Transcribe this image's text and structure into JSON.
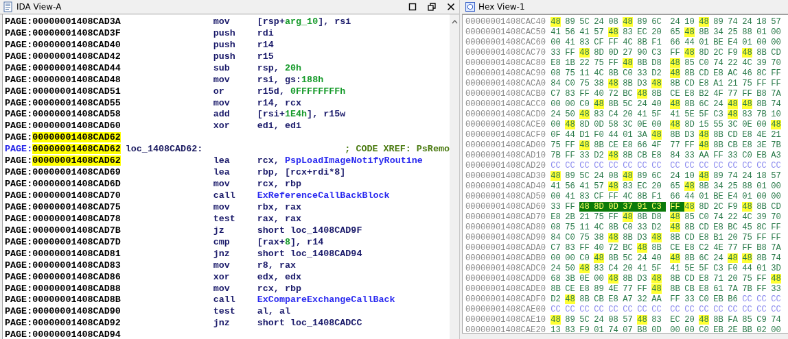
{
  "ida_view": {
    "title": "IDA View-A",
    "rows": [
      {
        "kind": "code",
        "seg": "PAGE:",
        "addr": "00000001408CAD3A",
        "highlight": false,
        "mnemonic": "mov",
        "operands": [
          {
            "text": "[rsp+",
            "kind": "plain"
          },
          {
            "text": "arg_10",
            "kind": "num"
          },
          {
            "text": "], rsi",
            "kind": "plain"
          }
        ]
      },
      {
        "kind": "code",
        "seg": "PAGE:",
        "addr": "00000001408CAD3F",
        "highlight": false,
        "mnemonic": "push",
        "operands": [
          {
            "text": "rdi",
            "kind": "plain"
          }
        ]
      },
      {
        "kind": "code",
        "seg": "PAGE:",
        "addr": "00000001408CAD40",
        "highlight": false,
        "mnemonic": "push",
        "operands": [
          {
            "text": "r14",
            "kind": "plain"
          }
        ]
      },
      {
        "kind": "code",
        "seg": "PAGE:",
        "addr": "00000001408CAD42",
        "highlight": false,
        "mnemonic": "push",
        "operands": [
          {
            "text": "r15",
            "kind": "plain"
          }
        ]
      },
      {
        "kind": "code",
        "seg": "PAGE:",
        "addr": "00000001408CAD44",
        "highlight": false,
        "mnemonic": "sub",
        "operands": [
          {
            "text": "rsp, ",
            "kind": "plain"
          },
          {
            "text": "20h",
            "kind": "num"
          }
        ]
      },
      {
        "kind": "code",
        "seg": "PAGE:",
        "addr": "00000001408CAD48",
        "highlight": false,
        "mnemonic": "mov",
        "operands": [
          {
            "text": "rsi, gs:",
            "kind": "plain"
          },
          {
            "text": "188h",
            "kind": "num"
          }
        ]
      },
      {
        "kind": "code",
        "seg": "PAGE:",
        "addr": "00000001408CAD51",
        "highlight": false,
        "mnemonic": "or",
        "operands": [
          {
            "text": "r15d, ",
            "kind": "plain"
          },
          {
            "text": "0FFFFFFFFh",
            "kind": "num"
          }
        ]
      },
      {
        "kind": "code",
        "seg": "PAGE:",
        "addr": "00000001408CAD55",
        "highlight": false,
        "mnemonic": "mov",
        "operands": [
          {
            "text": "r14, rcx",
            "kind": "plain"
          }
        ]
      },
      {
        "kind": "code",
        "seg": "PAGE:",
        "addr": "00000001408CAD58",
        "highlight": false,
        "mnemonic": "add",
        "operands": [
          {
            "text": "[rsi+",
            "kind": "plain"
          },
          {
            "text": "1E4h",
            "kind": "num"
          },
          {
            "text": "], r15w",
            "kind": "plain"
          }
        ]
      },
      {
        "kind": "code",
        "seg": "PAGE:",
        "addr": "00000001408CAD60",
        "highlight": false,
        "mnemonic": "xor",
        "operands": [
          {
            "text": "edi, edi",
            "kind": "plain"
          }
        ]
      },
      {
        "kind": "code",
        "seg": "PAGE:",
        "addr": "00000001408CAD62",
        "highlight": true
      },
      {
        "kind": "label",
        "seg": "PAGE:",
        "addr": "00000001408CAD62",
        "highlight": true,
        "label": "loc_1408CAD62:",
        "comment": "; CODE XREF: PsRemo"
      },
      {
        "kind": "code",
        "seg": "PAGE:",
        "addr": "00000001408CAD62",
        "highlight": true,
        "mnemonic": "lea",
        "operands": [
          {
            "text": "rcx, ",
            "kind": "plain"
          },
          {
            "text": "PspLoadImageNotifyRoutine",
            "kind": "name"
          }
        ]
      },
      {
        "kind": "code",
        "seg": "PAGE:",
        "addr": "00000001408CAD69",
        "highlight": false,
        "mnemonic": "lea",
        "operands": [
          {
            "text": "rbp, [rcx+rdi*8]",
            "kind": "plain"
          }
        ]
      },
      {
        "kind": "code",
        "seg": "PAGE:",
        "addr": "00000001408CAD6D",
        "highlight": false,
        "mnemonic": "mov",
        "operands": [
          {
            "text": "rcx, rbp",
            "kind": "plain"
          }
        ]
      },
      {
        "kind": "code",
        "seg": "PAGE:",
        "addr": "00000001408CAD70",
        "highlight": false,
        "mnemonic": "call",
        "operands": [
          {
            "text": "ExReferenceCallBackBlock",
            "kind": "name"
          }
        ]
      },
      {
        "kind": "code",
        "seg": "PAGE:",
        "addr": "00000001408CAD75",
        "highlight": false,
        "mnemonic": "mov",
        "operands": [
          {
            "text": "rbx, rax",
            "kind": "plain"
          }
        ]
      },
      {
        "kind": "code",
        "seg": "PAGE:",
        "addr": "00000001408CAD78",
        "highlight": false,
        "mnemonic": "test",
        "operands": [
          {
            "text": "rax, rax",
            "kind": "plain"
          }
        ]
      },
      {
        "kind": "code",
        "seg": "PAGE:",
        "addr": "00000001408CAD7B",
        "highlight": false,
        "mnemonic": "jz",
        "operands": [
          {
            "text": "short loc_1408CAD9F",
            "kind": "plain"
          }
        ]
      },
      {
        "kind": "code",
        "seg": "PAGE:",
        "addr": "00000001408CAD7D",
        "highlight": false,
        "mnemonic": "cmp",
        "operands": [
          {
            "text": "[rax+",
            "kind": "plain"
          },
          {
            "text": "8",
            "kind": "num"
          },
          {
            "text": "], r14",
            "kind": "plain"
          }
        ]
      },
      {
        "kind": "code",
        "seg": "PAGE:",
        "addr": "00000001408CAD81",
        "highlight": false,
        "mnemonic": "jnz",
        "operands": [
          {
            "text": "short loc_1408CAD94",
            "kind": "plain"
          }
        ]
      },
      {
        "kind": "code",
        "seg": "PAGE:",
        "addr": "00000001408CAD83",
        "highlight": false,
        "mnemonic": "mov",
        "operands": [
          {
            "text": "r8, rax",
            "kind": "plain"
          }
        ]
      },
      {
        "kind": "code",
        "seg": "PAGE:",
        "addr": "00000001408CAD86",
        "highlight": false,
        "mnemonic": "xor",
        "operands": [
          {
            "text": "edx, edx",
            "kind": "plain"
          }
        ]
      },
      {
        "kind": "code",
        "seg": "PAGE:",
        "addr": "00000001408CAD88",
        "highlight": false,
        "mnemonic": "mov",
        "operands": [
          {
            "text": "rcx, rbp",
            "kind": "plain"
          }
        ]
      },
      {
        "kind": "code",
        "seg": "PAGE:",
        "addr": "00000001408CAD8B",
        "highlight": false,
        "mnemonic": "call",
        "operands": [
          {
            "text": "ExCompareExchangeCallBack",
            "kind": "name"
          }
        ]
      },
      {
        "kind": "code",
        "seg": "PAGE:",
        "addr": "00000001408CAD90",
        "highlight": false,
        "mnemonic": "test",
        "operands": [
          {
            "text": "al, al",
            "kind": "plain"
          }
        ]
      },
      {
        "kind": "code",
        "seg": "PAGE:",
        "addr": "00000001408CAD92",
        "highlight": false,
        "mnemonic": "jnz",
        "operands": [
          {
            "text": "short loc_1408CADCC",
            "kind": "plain"
          }
        ]
      },
      {
        "kind": "code",
        "seg": "PAGE:",
        "addr": "00000001408CAD94",
        "highlight": false
      }
    ]
  },
  "hex_view": {
    "title": "Hex View-1",
    "rows": [
      {
        "addr": "00000001408CAC40",
        "bytes": [
          {
            "v": "48",
            "kind": "match"
          },
          {
            "v": "89"
          },
          {
            "v": "5C"
          },
          {
            "v": "24"
          },
          {
            "v": "08"
          },
          {
            "v": "48",
            "kind": "match"
          },
          {
            "v": "89"
          },
          {
            "v": "6C"
          },
          {
            "v": "24"
          },
          {
            "v": "10"
          },
          {
            "v": "48",
            "kind": "match"
          },
          {
            "v": "89"
          },
          {
            "v": "74"
          },
          {
            "v": "24"
          },
          {
            "v": "18"
          },
          {
            "v": "57"
          }
        ]
      },
      {
        "addr": "00000001408CAC50",
        "bytes": [
          {
            "v": "41"
          },
          {
            "v": "56"
          },
          {
            "v": "41"
          },
          {
            "v": "57"
          },
          {
            "v": "48",
            "kind": "match"
          },
          {
            "v": "83"
          },
          {
            "v": "EC"
          },
          {
            "v": "20"
          },
          {
            "v": "65"
          },
          {
            "v": "48",
            "kind": "match"
          },
          {
            "v": "8B"
          },
          {
            "v": "34"
          },
          {
            "v": "25"
          },
          {
            "v": "88"
          },
          {
            "v": "01"
          },
          {
            "v": "00"
          }
        ]
      },
      {
        "addr": "00000001408CAC60",
        "bytes": [
          {
            "v": "00"
          },
          {
            "v": "41"
          },
          {
            "v": "83"
          },
          {
            "v": "CF"
          },
          {
            "v": "FF"
          },
          {
            "v": "4C"
          },
          {
            "v": "8B"
          },
          {
            "v": "F1"
          },
          {
            "v": "66"
          },
          {
            "v": "44"
          },
          {
            "v": "01"
          },
          {
            "v": "BE"
          },
          {
            "v": "E4"
          },
          {
            "v": "01"
          },
          {
            "v": "00"
          },
          {
            "v": "00"
          }
        ]
      },
      {
        "addr": "00000001408CAC70",
        "bytes": [
          {
            "v": "33"
          },
          {
            "v": "FF"
          },
          {
            "v": "48",
            "kind": "match"
          },
          {
            "v": "8D"
          },
          {
            "v": "0D"
          },
          {
            "v": "27"
          },
          {
            "v": "90"
          },
          {
            "v": "C3"
          },
          {
            "v": "FF"
          },
          {
            "v": "48",
            "kind": "match"
          },
          {
            "v": "8D"
          },
          {
            "v": "2C"
          },
          {
            "v": "F9"
          },
          {
            "v": "48",
            "kind": "match"
          },
          {
            "v": "8B"
          },
          {
            "v": "CD"
          }
        ]
      },
      {
        "addr": "00000001408CAC80",
        "bytes": [
          {
            "v": "E8"
          },
          {
            "v": "1B"
          },
          {
            "v": "22"
          },
          {
            "v": "75"
          },
          {
            "v": "FF"
          },
          {
            "v": "48",
            "kind": "match"
          },
          {
            "v": "8B"
          },
          {
            "v": "D8"
          },
          {
            "v": "48",
            "kind": "match"
          },
          {
            "v": "85"
          },
          {
            "v": "C0"
          },
          {
            "v": "74"
          },
          {
            "v": "22"
          },
          {
            "v": "4C"
          },
          {
            "v": "39"
          },
          {
            "v": "70"
          }
        ]
      },
      {
        "addr": "00000001408CAC90",
        "bytes": [
          {
            "v": "08"
          },
          {
            "v": "75"
          },
          {
            "v": "11"
          },
          {
            "v": "4C"
          },
          {
            "v": "8B"
          },
          {
            "v": "C0"
          },
          {
            "v": "33"
          },
          {
            "v": "D2"
          },
          {
            "v": "48",
            "kind": "match"
          },
          {
            "v": "8B"
          },
          {
            "v": "CD"
          },
          {
            "v": "E8"
          },
          {
            "v": "AC"
          },
          {
            "v": "46"
          },
          {
            "v": "8C"
          },
          {
            "v": "FF"
          }
        ]
      },
      {
        "addr": "00000001408CACA0",
        "bytes": [
          {
            "v": "84"
          },
          {
            "v": "C0"
          },
          {
            "v": "75"
          },
          {
            "v": "38"
          },
          {
            "v": "48",
            "kind": "match"
          },
          {
            "v": "8B"
          },
          {
            "v": "D3"
          },
          {
            "v": "48",
            "kind": "match"
          },
          {
            "v": "8B"
          },
          {
            "v": "CD"
          },
          {
            "v": "E8"
          },
          {
            "v": "A1"
          },
          {
            "v": "21"
          },
          {
            "v": "75"
          },
          {
            "v": "FF"
          },
          {
            "v": "FF"
          }
        ]
      },
      {
        "addr": "00000001408CACB0",
        "bytes": [
          {
            "v": "C7"
          },
          {
            "v": "83"
          },
          {
            "v": "FF"
          },
          {
            "v": "40"
          },
          {
            "v": "72"
          },
          {
            "v": "BC"
          },
          {
            "v": "48",
            "kind": "match"
          },
          {
            "v": "8B"
          },
          {
            "v": "CE"
          },
          {
            "v": "E8"
          },
          {
            "v": "B2"
          },
          {
            "v": "4F"
          },
          {
            "v": "77"
          },
          {
            "v": "FF"
          },
          {
            "v": "B8"
          },
          {
            "v": "7A"
          }
        ]
      },
      {
        "addr": "00000001408CACC0",
        "bytes": [
          {
            "v": "00"
          },
          {
            "v": "00"
          },
          {
            "v": "C0"
          },
          {
            "v": "48",
            "kind": "match"
          },
          {
            "v": "8B"
          },
          {
            "v": "5C"
          },
          {
            "v": "24"
          },
          {
            "v": "40"
          },
          {
            "v": "48",
            "kind": "match"
          },
          {
            "v": "8B"
          },
          {
            "v": "6C"
          },
          {
            "v": "24"
          },
          {
            "v": "48",
            "kind": "match"
          },
          {
            "v": "48",
            "kind": "match"
          },
          {
            "v": "8B"
          },
          {
            "v": "74"
          }
        ]
      },
      {
        "addr": "00000001408CACD0",
        "bytes": [
          {
            "v": "24"
          },
          {
            "v": "50"
          },
          {
            "v": "48",
            "kind": "match"
          },
          {
            "v": "83"
          },
          {
            "v": "C4"
          },
          {
            "v": "20"
          },
          {
            "v": "41"
          },
          {
            "v": "5F"
          },
          {
            "v": "41"
          },
          {
            "v": "5E"
          },
          {
            "v": "5F"
          },
          {
            "v": "C3"
          },
          {
            "v": "48",
            "kind": "match"
          },
          {
            "v": "83"
          },
          {
            "v": "7B"
          },
          {
            "v": "10"
          }
        ]
      },
      {
        "addr": "00000001408CACE0",
        "bytes": [
          {
            "v": "00"
          },
          {
            "v": "48",
            "kind": "match"
          },
          {
            "v": "8D"
          },
          {
            "v": "0D"
          },
          {
            "v": "58"
          },
          {
            "v": "3C"
          },
          {
            "v": "0E"
          },
          {
            "v": "00"
          },
          {
            "v": "48",
            "kind": "match"
          },
          {
            "v": "8D"
          },
          {
            "v": "15"
          },
          {
            "v": "55"
          },
          {
            "v": "3C"
          },
          {
            "v": "0E"
          },
          {
            "v": "00"
          },
          {
            "v": "48",
            "kind": "match"
          }
        ]
      },
      {
        "addr": "00000001408CACF0",
        "bytes": [
          {
            "v": "0F"
          },
          {
            "v": "44"
          },
          {
            "v": "D1"
          },
          {
            "v": "F0"
          },
          {
            "v": "44"
          },
          {
            "v": "01"
          },
          {
            "v": "3A"
          },
          {
            "v": "48",
            "kind": "match"
          },
          {
            "v": "8B"
          },
          {
            "v": "D3"
          },
          {
            "v": "48",
            "kind": "match"
          },
          {
            "v": "8B"
          },
          {
            "v": "CD"
          },
          {
            "v": "E8"
          },
          {
            "v": "4E"
          },
          {
            "v": "21"
          }
        ]
      },
      {
        "addr": "00000001408CAD00",
        "bytes": [
          {
            "v": "75"
          },
          {
            "v": "FF"
          },
          {
            "v": "48",
            "kind": "match"
          },
          {
            "v": "8B"
          },
          {
            "v": "CE"
          },
          {
            "v": "E8"
          },
          {
            "v": "66"
          },
          {
            "v": "4F"
          },
          {
            "v": "77"
          },
          {
            "v": "FF"
          },
          {
            "v": "48",
            "kind": "match"
          },
          {
            "v": "8B"
          },
          {
            "v": "CB"
          },
          {
            "v": "E8"
          },
          {
            "v": "3E"
          },
          {
            "v": "7B"
          }
        ]
      },
      {
        "addr": "00000001408CAD10",
        "bytes": [
          {
            "v": "7B"
          },
          {
            "v": "FF"
          },
          {
            "v": "33"
          },
          {
            "v": "D2"
          },
          {
            "v": "48",
            "kind": "match"
          },
          {
            "v": "8B"
          },
          {
            "v": "CB"
          },
          {
            "v": "E8"
          },
          {
            "v": "84"
          },
          {
            "v": "33"
          },
          {
            "v": "AA"
          },
          {
            "v": "FF"
          },
          {
            "v": "33"
          },
          {
            "v": "C0"
          },
          {
            "v": "EB"
          },
          {
            "v": "A3"
          }
        ]
      },
      {
        "addr": "00000001408CAD20",
        "bytes": [
          {
            "v": "CC",
            "kind": "filler"
          },
          {
            "v": "CC",
            "kind": "filler"
          },
          {
            "v": "CC",
            "kind": "filler"
          },
          {
            "v": "CC",
            "kind": "filler"
          },
          {
            "v": "CC",
            "kind": "filler"
          },
          {
            "v": "CC",
            "kind": "filler"
          },
          {
            "v": "CC",
            "kind": "filler"
          },
          {
            "v": "CC",
            "kind": "filler"
          },
          {
            "v": "CC",
            "kind": "filler"
          },
          {
            "v": "CC",
            "kind": "filler"
          },
          {
            "v": "CC",
            "kind": "filler"
          },
          {
            "v": "CC",
            "kind": "filler"
          },
          {
            "v": "CC",
            "kind": "filler"
          },
          {
            "v": "CC",
            "kind": "filler"
          },
          {
            "v": "CC",
            "kind": "filler"
          },
          {
            "v": "CC",
            "kind": "filler"
          }
        ]
      },
      {
        "addr": "00000001408CAD30",
        "bytes": [
          {
            "v": "48",
            "kind": "match"
          },
          {
            "v": "89"
          },
          {
            "v": "5C"
          },
          {
            "v": "24"
          },
          {
            "v": "08"
          },
          {
            "v": "48",
            "kind": "match"
          },
          {
            "v": "89"
          },
          {
            "v": "6C"
          },
          {
            "v": "24"
          },
          {
            "v": "10"
          },
          {
            "v": "48",
            "kind": "match"
          },
          {
            "v": "89"
          },
          {
            "v": "74"
          },
          {
            "v": "24"
          },
          {
            "v": "18"
          },
          {
            "v": "57"
          }
        ]
      },
      {
        "addr": "00000001408CAD40",
        "bytes": [
          {
            "v": "41"
          },
          {
            "v": "56"
          },
          {
            "v": "41"
          },
          {
            "v": "57"
          },
          {
            "v": "48",
            "kind": "match"
          },
          {
            "v": "83"
          },
          {
            "v": "EC"
          },
          {
            "v": "20"
          },
          {
            "v": "65"
          },
          {
            "v": "48",
            "kind": "match"
          },
          {
            "v": "8B"
          },
          {
            "v": "34"
          },
          {
            "v": "25"
          },
          {
            "v": "88"
          },
          {
            "v": "01"
          },
          {
            "v": "00"
          }
        ]
      },
      {
        "addr": "00000001408CAD50",
        "bytes": [
          {
            "v": "00"
          },
          {
            "v": "41"
          },
          {
            "v": "83"
          },
          {
            "v": "CF"
          },
          {
            "v": "FF"
          },
          {
            "v": "4C"
          },
          {
            "v": "8B"
          },
          {
            "v": "F1"
          },
          {
            "v": "66"
          },
          {
            "v": "44"
          },
          {
            "v": "01"
          },
          {
            "v": "BE"
          },
          {
            "v": "E4"
          },
          {
            "v": "01"
          },
          {
            "v": "00"
          },
          {
            "v": "00"
          }
        ]
      },
      {
        "addr": "00000001408CAD60",
        "bytes": [
          {
            "v": "33"
          },
          {
            "v": "FF"
          },
          {
            "v": "48",
            "kind": "selected"
          },
          {
            "v": "8D",
            "kind": "selected"
          },
          {
            "v": "0D",
            "kind": "selected"
          },
          {
            "v": "37",
            "kind": "selected"
          },
          {
            "v": "91",
            "kind": "selected"
          },
          {
            "v": "C3",
            "kind": "selected"
          },
          {
            "v": "FF",
            "kind": "selected"
          },
          {
            "v": "48",
            "kind": "match"
          },
          {
            "v": "8D"
          },
          {
            "v": "2C"
          },
          {
            "v": "F9"
          },
          {
            "v": "48",
            "kind": "match"
          },
          {
            "v": "8B"
          },
          {
            "v": "CD"
          }
        ]
      },
      {
        "addr": "00000001408CAD70",
        "bytes": [
          {
            "v": "E8"
          },
          {
            "v": "2B"
          },
          {
            "v": "21"
          },
          {
            "v": "75"
          },
          {
            "v": "FF"
          },
          {
            "v": "48",
            "kind": "match"
          },
          {
            "v": "8B"
          },
          {
            "v": "D8"
          },
          {
            "v": "48",
            "kind": "match"
          },
          {
            "v": "85"
          },
          {
            "v": "C0"
          },
          {
            "v": "74"
          },
          {
            "v": "22"
          },
          {
            "v": "4C"
          },
          {
            "v": "39"
          },
          {
            "v": "70"
          }
        ]
      },
      {
        "addr": "00000001408CAD80",
        "bytes": [
          {
            "v": "08"
          },
          {
            "v": "75"
          },
          {
            "v": "11"
          },
          {
            "v": "4C"
          },
          {
            "v": "8B"
          },
          {
            "v": "C0"
          },
          {
            "v": "33"
          },
          {
            "v": "D2"
          },
          {
            "v": "48",
            "kind": "match"
          },
          {
            "v": "8B"
          },
          {
            "v": "CD"
          },
          {
            "v": "E8"
          },
          {
            "v": "BC"
          },
          {
            "v": "45"
          },
          {
            "v": "8C"
          },
          {
            "v": "FF"
          }
        ]
      },
      {
        "addr": "00000001408CAD90",
        "bytes": [
          {
            "v": "84"
          },
          {
            "v": "C0"
          },
          {
            "v": "75"
          },
          {
            "v": "38"
          },
          {
            "v": "48",
            "kind": "match"
          },
          {
            "v": "8B"
          },
          {
            "v": "D3"
          },
          {
            "v": "48",
            "kind": "match"
          },
          {
            "v": "8B"
          },
          {
            "v": "CD"
          },
          {
            "v": "E8"
          },
          {
            "v": "B1"
          },
          {
            "v": "20"
          },
          {
            "v": "75"
          },
          {
            "v": "FF"
          },
          {
            "v": "FF"
          }
        ]
      },
      {
        "addr": "00000001408CADA0",
        "bytes": [
          {
            "v": "C7"
          },
          {
            "v": "83"
          },
          {
            "v": "FF"
          },
          {
            "v": "40"
          },
          {
            "v": "72"
          },
          {
            "v": "BC"
          },
          {
            "v": "48",
            "kind": "match"
          },
          {
            "v": "8B"
          },
          {
            "v": "CE"
          },
          {
            "v": "E8"
          },
          {
            "v": "C2"
          },
          {
            "v": "4E"
          },
          {
            "v": "77"
          },
          {
            "v": "FF"
          },
          {
            "v": "B8"
          },
          {
            "v": "7A"
          }
        ]
      },
      {
        "addr": "00000001408CADB0",
        "bytes": [
          {
            "v": "00"
          },
          {
            "v": "00"
          },
          {
            "v": "C0"
          },
          {
            "v": "48",
            "kind": "match"
          },
          {
            "v": "8B"
          },
          {
            "v": "5C"
          },
          {
            "v": "24"
          },
          {
            "v": "40"
          },
          {
            "v": "48",
            "kind": "match"
          },
          {
            "v": "8B"
          },
          {
            "v": "6C"
          },
          {
            "v": "24"
          },
          {
            "v": "48",
            "kind": "match"
          },
          {
            "v": "48",
            "kind": "match"
          },
          {
            "v": "8B"
          },
          {
            "v": "74"
          }
        ]
      },
      {
        "addr": "00000001408CADC0",
        "bytes": [
          {
            "v": "24"
          },
          {
            "v": "50"
          },
          {
            "v": "48",
            "kind": "match"
          },
          {
            "v": "83"
          },
          {
            "v": "C4"
          },
          {
            "v": "20"
          },
          {
            "v": "41"
          },
          {
            "v": "5F"
          },
          {
            "v": "41"
          },
          {
            "v": "5E"
          },
          {
            "v": "5F"
          },
          {
            "v": "C3"
          },
          {
            "v": "F0"
          },
          {
            "v": "44"
          },
          {
            "v": "01"
          },
          {
            "v": "3D"
          }
        ]
      },
      {
        "addr": "00000001408CADD0",
        "bytes": [
          {
            "v": "68"
          },
          {
            "v": "3B"
          },
          {
            "v": "0E"
          },
          {
            "v": "00"
          },
          {
            "v": "48",
            "kind": "match"
          },
          {
            "v": "8B"
          },
          {
            "v": "D3"
          },
          {
            "v": "48",
            "kind": "match"
          },
          {
            "v": "8B"
          },
          {
            "v": "CD"
          },
          {
            "v": "E8"
          },
          {
            "v": "71"
          },
          {
            "v": "20"
          },
          {
            "v": "75"
          },
          {
            "v": "FF"
          },
          {
            "v": "48",
            "kind": "match"
          }
        ]
      },
      {
        "addr": "00000001408CADE0",
        "bytes": [
          {
            "v": "8B"
          },
          {
            "v": "CE"
          },
          {
            "v": "E8"
          },
          {
            "v": "89"
          },
          {
            "v": "4E"
          },
          {
            "v": "77"
          },
          {
            "v": "FF"
          },
          {
            "v": "48",
            "kind": "match"
          },
          {
            "v": "8B"
          },
          {
            "v": "CB"
          },
          {
            "v": "E8"
          },
          {
            "v": "61"
          },
          {
            "v": "7A"
          },
          {
            "v": "7B"
          },
          {
            "v": "FF"
          },
          {
            "v": "33"
          }
        ]
      },
      {
        "addr": "00000001408CADF0",
        "bytes": [
          {
            "v": "D2"
          },
          {
            "v": "48",
            "kind": "match"
          },
          {
            "v": "8B"
          },
          {
            "v": "CB"
          },
          {
            "v": "E8"
          },
          {
            "v": "A7"
          },
          {
            "v": "32"
          },
          {
            "v": "AA"
          },
          {
            "v": "FF"
          },
          {
            "v": "33"
          },
          {
            "v": "C0"
          },
          {
            "v": "EB"
          },
          {
            "v": "B6"
          },
          {
            "v": "CC",
            "kind": "filler"
          },
          {
            "v": "CC",
            "kind": "filler"
          },
          {
            "v": "CC",
            "kind": "filler"
          }
        ]
      },
      {
        "addr": "00000001408CAE00",
        "bytes": [
          {
            "v": "CC",
            "kind": "filler"
          },
          {
            "v": "CC",
            "kind": "filler"
          },
          {
            "v": "CC",
            "kind": "filler"
          },
          {
            "v": "CC",
            "kind": "filler"
          },
          {
            "v": "CC",
            "kind": "filler"
          },
          {
            "v": "CC",
            "kind": "filler"
          },
          {
            "v": "CC",
            "kind": "filler"
          },
          {
            "v": "CC",
            "kind": "filler"
          },
          {
            "v": "CC",
            "kind": "filler"
          },
          {
            "v": "CC",
            "kind": "filler"
          },
          {
            "v": "CC",
            "kind": "filler"
          },
          {
            "v": "CC",
            "kind": "filler"
          },
          {
            "v": "CC",
            "kind": "filler"
          },
          {
            "v": "CC",
            "kind": "filler"
          },
          {
            "v": "CC",
            "kind": "filler"
          },
          {
            "v": "CC",
            "kind": "filler"
          }
        ]
      },
      {
        "addr": "00000001408CAE10",
        "bytes": [
          {
            "v": "48",
            "kind": "match"
          },
          {
            "v": "89"
          },
          {
            "v": "5C"
          },
          {
            "v": "24"
          },
          {
            "v": "08"
          },
          {
            "v": "57"
          },
          {
            "v": "48",
            "kind": "match"
          },
          {
            "v": "83"
          },
          {
            "v": "EC"
          },
          {
            "v": "20"
          },
          {
            "v": "48",
            "kind": "match"
          },
          {
            "v": "8B"
          },
          {
            "v": "FA"
          },
          {
            "v": "85"
          },
          {
            "v": "C9"
          },
          {
            "v": "74"
          }
        ]
      },
      {
        "addr": "00000001408CAE20",
        "bytes": [
          {
            "v": "13"
          },
          {
            "v": "83"
          },
          {
            "v": "F9"
          },
          {
            "v": "01"
          },
          {
            "v": "74"
          },
          {
            "v": "07"
          },
          {
            "v": "B8"
          },
          {
            "v": "0D"
          },
          {
            "v": "00"
          },
          {
            "v": "00"
          },
          {
            "v": "C0"
          },
          {
            "v": "EB"
          },
          {
            "v": "2E"
          },
          {
            "v": "BB"
          },
          {
            "v": "02"
          },
          {
            "v": "00"
          }
        ]
      }
    ]
  }
}
